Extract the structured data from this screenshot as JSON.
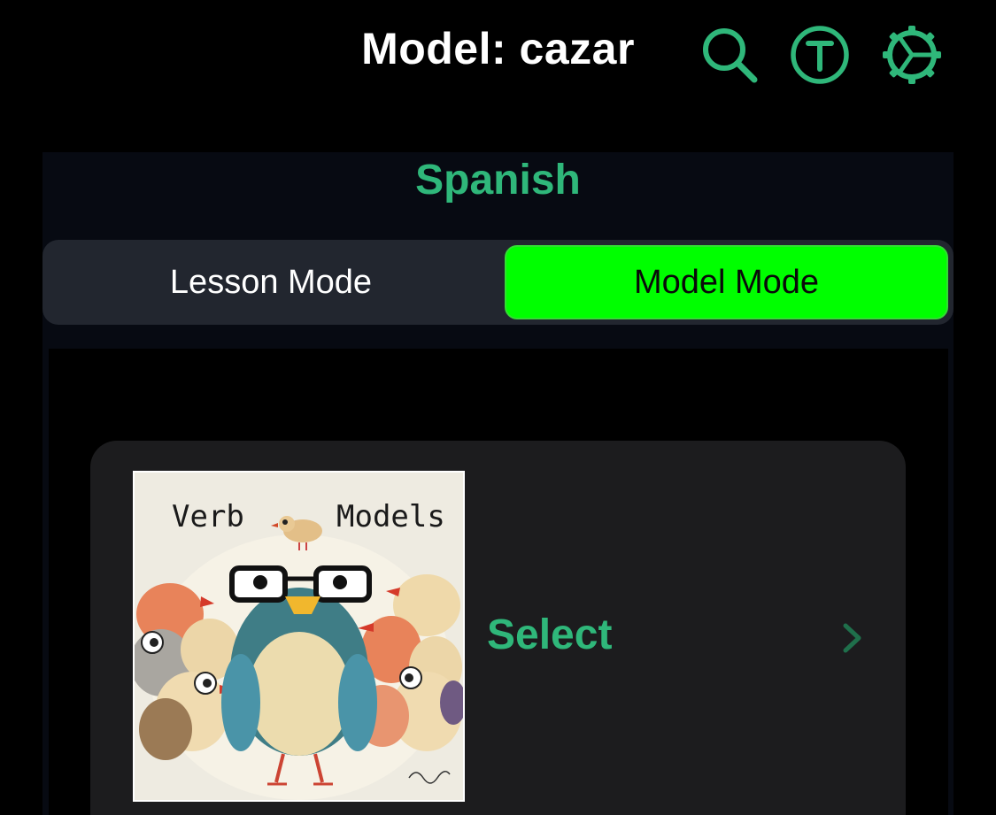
{
  "header": {
    "title": "Model: cazar",
    "icons": [
      "search-icon",
      "translate-t-icon",
      "settings-gear-icon"
    ],
    "accent_color": "#2fb77a"
  },
  "panel": {
    "title": "Spanish",
    "modes": {
      "lesson_label": "Lesson Mode",
      "model_label": "Model Mode",
      "selected": "Model Mode",
      "selected_color": "#00ff00"
    }
  },
  "card": {
    "image_caption_left": "Verb",
    "image_caption_right": "Models",
    "action_label": "Select",
    "chevron_icon": "chevron-right-icon"
  }
}
